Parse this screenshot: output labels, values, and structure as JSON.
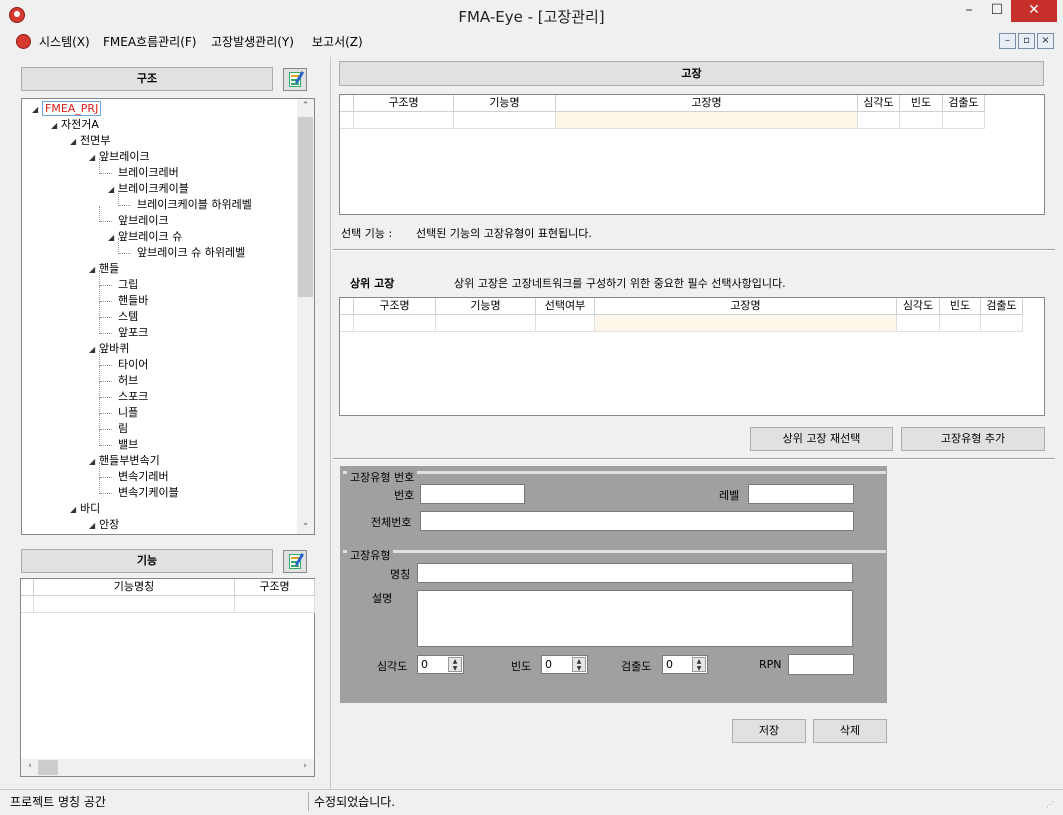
{
  "window": {
    "title": "FMA-Eye - [고장관리]",
    "minimize": "–",
    "maximize": "☐",
    "close": "✕"
  },
  "menu": {
    "items": [
      "시스템(X)",
      "FMEA흐름관리(F)",
      "고장발생관리(Y)",
      "보고서(Z)"
    ],
    "mdi": [
      "–",
      "▫",
      "×"
    ]
  },
  "left": {
    "structure_button": "구조",
    "function_button": "기능",
    "tree": [
      {
        "label": "FMEA_PRJ",
        "level": 0,
        "expanded": true
      },
      {
        "label": "자전거A",
        "level": 1,
        "expanded": true
      },
      {
        "label": "전면부",
        "level": 2,
        "expanded": true
      },
      {
        "label": "앞브레이크",
        "level": 3,
        "expanded": true
      },
      {
        "label": "브레이크레버",
        "level": 4
      },
      {
        "label": "브레이크케이블",
        "level": 4,
        "expanded": true
      },
      {
        "label": "브레이크케이블 하위레벨",
        "level": 5
      },
      {
        "label": "앞브레이크",
        "level": 4
      },
      {
        "label": "앞브레이크 슈",
        "level": 4,
        "expanded": true
      },
      {
        "label": "앞브레이크 슈 하위레벨",
        "level": 5
      },
      {
        "label": "핸들",
        "level": 3,
        "expanded": true
      },
      {
        "label": "그립",
        "level": 4
      },
      {
        "label": "핸들바",
        "level": 4
      },
      {
        "label": "스템",
        "level": 4
      },
      {
        "label": "앞포크",
        "level": 4
      },
      {
        "label": "앞바퀴",
        "level": 3,
        "expanded": true
      },
      {
        "label": "타이어",
        "level": 4
      },
      {
        "label": "허브",
        "level": 4
      },
      {
        "label": "스포크",
        "level": 4
      },
      {
        "label": "니플",
        "level": 4
      },
      {
        "label": "림",
        "level": 4
      },
      {
        "label": "밸브",
        "level": 4
      },
      {
        "label": "핸들부변속기",
        "level": 3,
        "expanded": true
      },
      {
        "label": "변속기레버",
        "level": 4
      },
      {
        "label": "변속기케이블",
        "level": 4
      },
      {
        "label": "바디",
        "level": 2,
        "expanded": true
      },
      {
        "label": "안장",
        "level": 3,
        "expanded": true
      }
    ],
    "function_grid": {
      "columns": [
        "기능명칭",
        "구조명"
      ]
    }
  },
  "failure": {
    "header": "고장",
    "columns": [
      "구조명",
      "기능명",
      "고장명",
      "심각도",
      "빈도",
      "검출도"
    ],
    "selected_function_label": "선택 기능 :",
    "selected_function_value": "선택된 기능의 고장유형이 표현됩니다."
  },
  "upper_failure": {
    "title": "상위 고장",
    "description": "상위 고장은 고장네트워크를 구성하기 위한 중요한 필수 선택사항입니다.",
    "columns": [
      "구조명",
      "기능명",
      "선택여부",
      "고장명",
      "심각도",
      "빈도",
      "검출도"
    ],
    "reselect_button": "상위 고장 재선택",
    "add_type_button": "고장유형 추가"
  },
  "form": {
    "group1_title": "고장유형 번호",
    "number_label": "번호",
    "number_value": "",
    "level_label": "레벨",
    "level_value": "",
    "full_number_label": "전체번호",
    "full_number_value": "",
    "group2_title": "고장유형",
    "name_label": "명칭",
    "name_value": "",
    "desc_label": "설명",
    "desc_value": "",
    "severity_label": "심각도",
    "severity_value": "0",
    "frequency_label": "빈도",
    "frequency_value": "0",
    "detection_label": "검출도",
    "detection_value": "0",
    "rpn_label": "RPN",
    "rpn_value": "",
    "save_button": "저장",
    "delete_button": "삭제"
  },
  "status": {
    "left": "프로젝트 명칭 공간",
    "right": "수정되었습니다."
  }
}
